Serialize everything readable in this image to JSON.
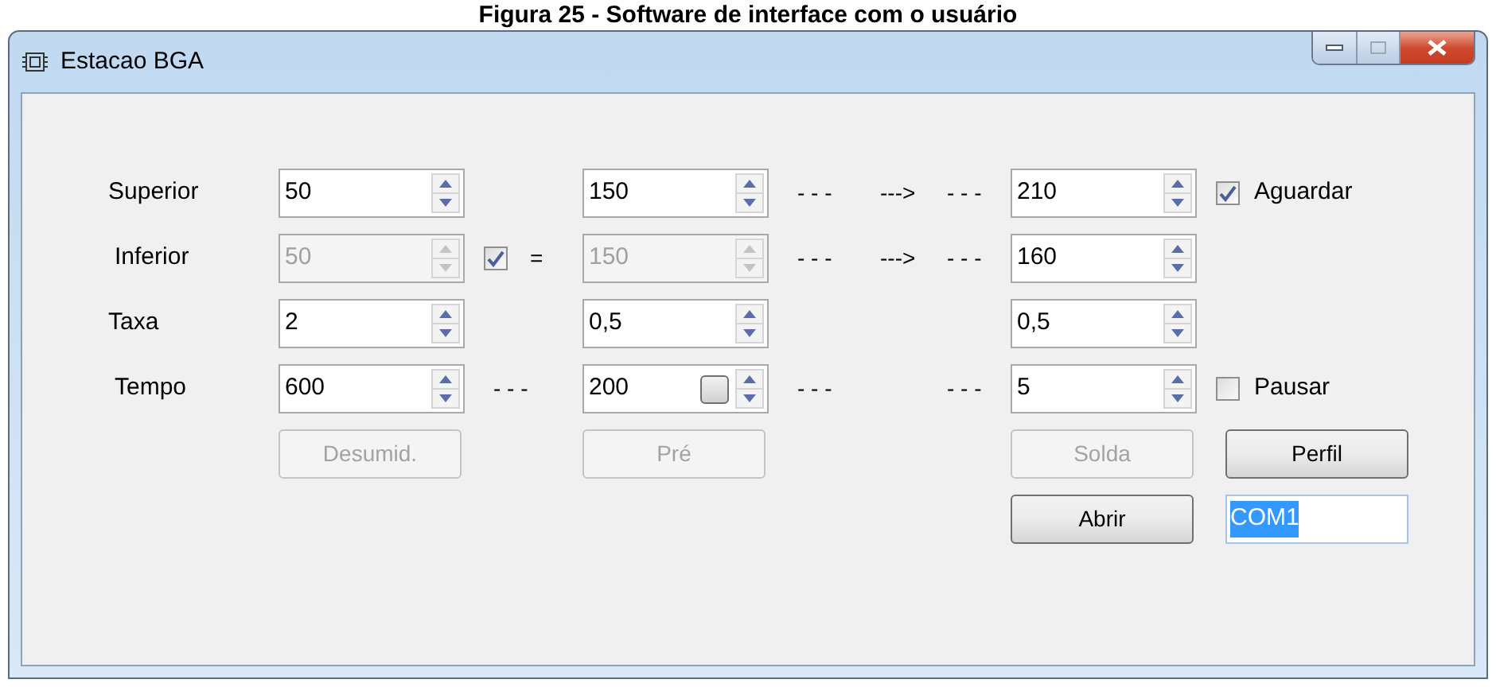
{
  "caption": "Figura 25 - Software de interface com o usuário",
  "window": {
    "title": "Estacao BGA"
  },
  "rows": [
    {
      "label": "Superior",
      "field_1": {
        "value": "50",
        "disabled": false
      },
      "field_2": {
        "value": "150",
        "disabled": false
      },
      "flow": {
        "left": "- - -",
        "arrow": "--->",
        "right": "- - -"
      },
      "field_3": {
        "value": "210",
        "disabled": false
      },
      "option": {
        "label": "Aguardar",
        "checked": true
      }
    },
    {
      "label": "Inferior",
      "field_1": {
        "value": "50",
        "disabled": true
      },
      "link": {
        "checked": true,
        "sign": "="
      },
      "field_2": {
        "value": "150",
        "disabled": true
      },
      "flow": {
        "left": "- - -",
        "arrow": "--->",
        "right": "- - -"
      },
      "field_3": {
        "value": "160",
        "disabled": false
      }
    },
    {
      "label": "Taxa",
      "field_1": {
        "value": "2",
        "disabled": false
      },
      "field_2": {
        "value": "0,5",
        "disabled": false
      },
      "field_3": {
        "value": "0,5",
        "disabled": false
      }
    },
    {
      "label": "Tempo",
      "field_1": {
        "value": "600",
        "disabled": false
      },
      "gap": "- - -",
      "field_2": {
        "value": "200",
        "disabled": false,
        "inner_button": true
      },
      "flow": {
        "left": "- - -",
        "right": "- - -"
      },
      "field_3": {
        "value": "5",
        "disabled": false
      },
      "option": {
        "label": "Pausar",
        "checked": false
      }
    }
  ],
  "buttons": [
    {
      "label": "Desumid.",
      "disabled": true
    },
    {
      "label": "Pré",
      "disabled": true
    },
    {
      "label": "Solda",
      "disabled": true
    },
    {
      "label": "Perfil",
      "disabled": false
    }
  ],
  "open_button": {
    "label": "Abrir",
    "disabled": false
  },
  "port": {
    "value": "COM1",
    "highlighted": true
  }
}
